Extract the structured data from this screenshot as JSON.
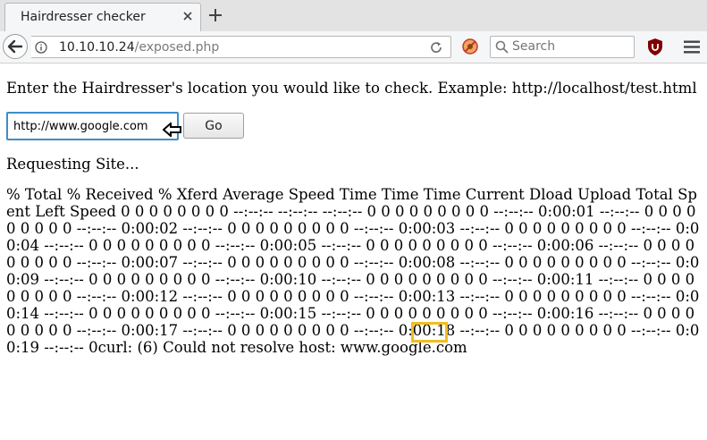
{
  "tab": {
    "title": "Hairdresser checker"
  },
  "navbar": {
    "url_host": "10.10.10.24",
    "url_path": "/exposed.php",
    "search_placeholder": "Search"
  },
  "page": {
    "prompt": "Enter the Hairdresser's location you would like to check. Example: http://localhost/test.html",
    "input_value": "http://www.google.com",
    "go_label": "Go",
    "requesting": "Requesting Site...",
    "output": "% Total % Received % Xferd Average Speed Time Time Time Current Dload Upload Total Spent Left Speed 0 0 0 0 0 0 0 0 --:--:-- --:--:-- --:--:-- 0 0 0 0 0 0 0 0 0 --:--:-- 0:00:01 --:--:-- 0 0 0 0 0 0 0 0 0 --:--:-- 0:00:02 --:--:-- 0 0 0 0 0 0 0 0 0 --:--:-- 0:00:03 --:--:-- 0 0 0 0 0 0 0 0 0 --:--:-- 0:00:04 --:--:-- 0 0 0 0 0 0 0 0 0 --:--:-- 0:00:05 --:--:-- 0 0 0 0 0 0 0 0 0 --:--:-- 0:00:06 --:--:-- 0 0 0 0 0 0 0 0 0 --:--:-- 0:00:07 --:--:-- 0 0 0 0 0 0 0 0 0 --:--:-- 0:00:08 --:--:-- 0 0 0 0 0 0 0 0 0 --:--:-- 0:00:09 --:--:-- 0 0 0 0 0 0 0 0 0 --:--:-- 0:00:10 --:--:-- 0 0 0 0 0 0 0 0 0 --:--:-- 0:00:11 --:--:-- 0 0 0 0 0 0 0 0 0 --:--:-- 0:00:12 --:--:-- 0 0 0 0 0 0 0 0 0 --:--:-- 0:00:13 --:--:-- 0 0 0 0 0 0 0 0 0 --:--:-- 0:00:14 --:--:-- 0 0 0 0 0 0 0 0 0 --:--:-- 0:00:15 --:--:-- 0 0 0 0 0 0 0 0 0 --:--:-- 0:00:16 --:--:-- 0 0 0 0 0 0 0 0 0 --:--:-- 0:00:17 --:--:-- 0 0 0 0 0 0 0 0 0 --:--:-- 0:00:18 --:--:-- 0 0 0 0 0 0 0 0 0 --:--:-- 0:00:19 --:--:-- 0curl: (6) Could not resolve host: www.google.com"
  },
  "colors": {
    "input_focus_border": "#3d8ec7",
    "highlight_box": "#f2bd1e"
  }
}
